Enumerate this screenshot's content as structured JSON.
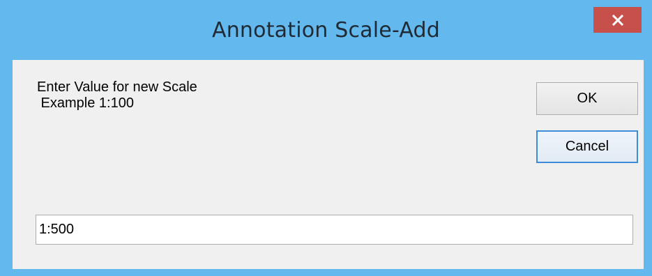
{
  "window": {
    "title": "Annotation Scale-Add",
    "close_icon": "close-icon",
    "colors": {
      "frame": "#63b8ee",
      "close_button": "#c7504a",
      "client": "#f0f0f0",
      "default_button_border": "#3c8cd8"
    }
  },
  "prompt": {
    "line1": "Enter Value for new Scale",
    "line2": " Example 1:100"
  },
  "buttons": {
    "ok_label": "OK",
    "cancel_label": "Cancel"
  },
  "input": {
    "value": "1:500"
  }
}
